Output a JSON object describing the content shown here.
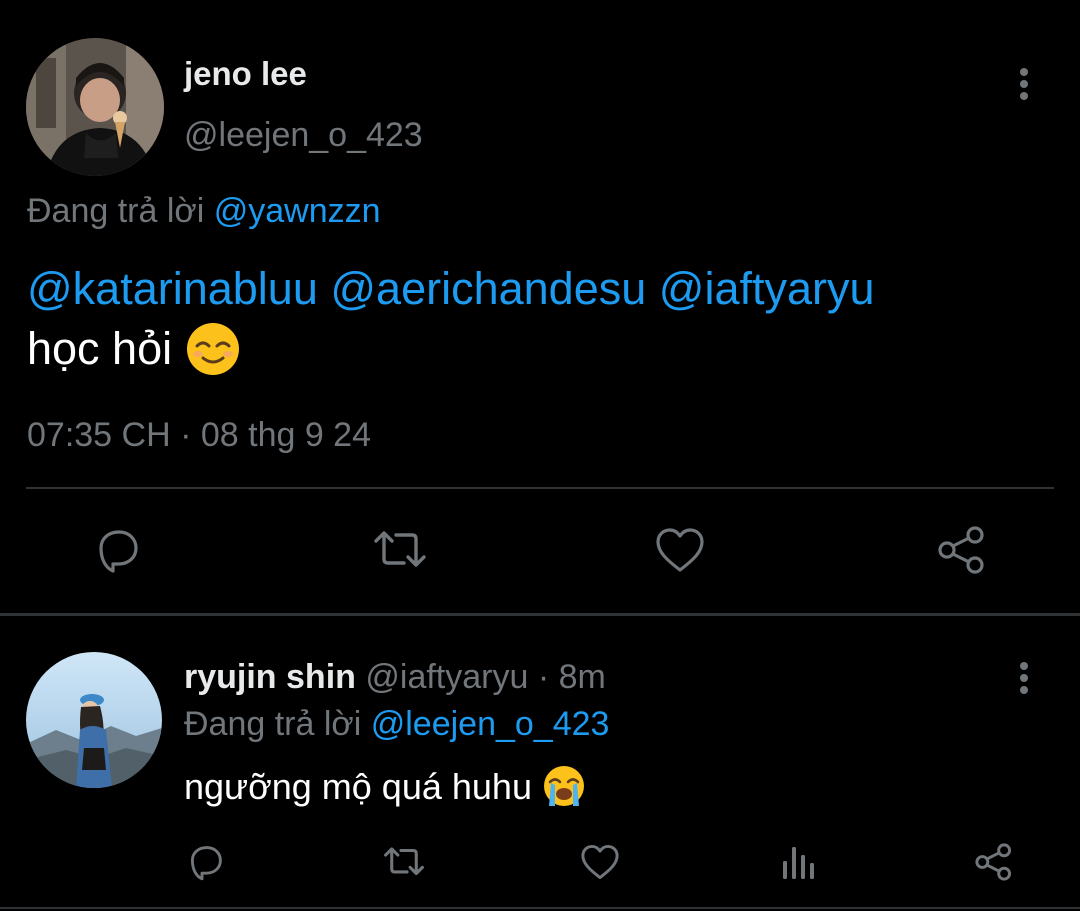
{
  "main_tweet": {
    "author_name": "jeno lee",
    "author_handle": "@leejen_o_423",
    "reply_prefix": "Đang trả lời",
    "reply_to": "@yawnzzn",
    "mentions": [
      "@katarinabluu",
      "@aerichandesu",
      "@iaftyaryu"
    ],
    "text": "học hỏi",
    "emoji": "relieved-face",
    "timestamp": "07:35 CH · 08 thg 9 24"
  },
  "reply_tweet": {
    "author_name": "ryujin shin",
    "author_handle": "@iaftyaryu",
    "time_ago": "· 8m",
    "reply_prefix": "Đang trả lời",
    "reply_to": "@leejen_o_423",
    "text": "ngưỡng mộ quá huhu",
    "emoji": "loudly-crying-face"
  },
  "colors": {
    "background": "#000000",
    "text": "#e7e9ea",
    "muted": "#71767b",
    "link": "#1d9bf0",
    "divider": "#2f3336"
  }
}
